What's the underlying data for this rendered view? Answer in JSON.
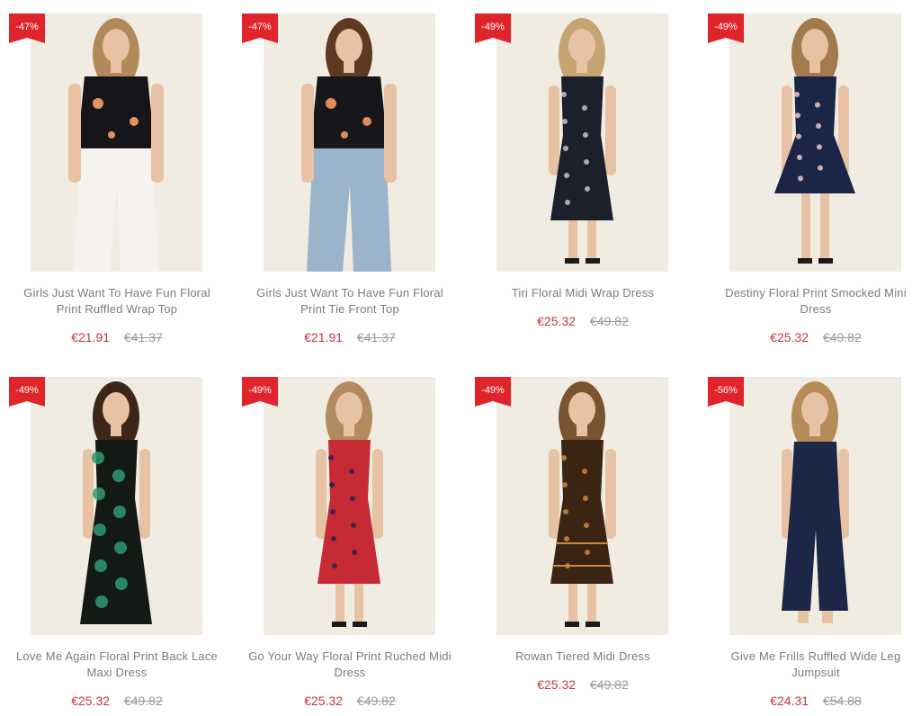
{
  "products": [
    {
      "badge": "-47%",
      "title": "Girls Just Want To Have Fun Floral Print Ruffled Wrap Top",
      "sale_price": "€21.91",
      "old_price": "€41.37",
      "colors": {
        "garment": "#16161a",
        "pattern": "#e3935f",
        "bottom": "#f6f3ee",
        "hair": "#b2895b"
      }
    },
    {
      "badge": "-47%",
      "title": "Girls Just Want To Have Fun Floral Print Tie Front Top",
      "sale_price": "€21.91",
      "old_price": "€41.37",
      "colors": {
        "garment": "#17171b",
        "pattern": "#e08c5b",
        "bottom": "#9bb3cb",
        "hair": "#5e3a22"
      }
    },
    {
      "badge": "-49%",
      "title": "Tiri Floral Midi Wrap Dress",
      "sale_price": "€25.32",
      "old_price": "€49.82",
      "colors": {
        "garment": "#1c1f2c",
        "pattern": "#c9c2d4",
        "bottom": "#1c1f2c",
        "hair": "#c6a372"
      }
    },
    {
      "badge": "-49%",
      "title": "Destiny Floral Print Smocked Mini Dress",
      "sale_price": "€25.32",
      "old_price": "€49.82",
      "colors": {
        "garment": "#1b2547",
        "pattern": "#e8c9c4",
        "bottom": "#1b2547",
        "hair": "#a37a4c"
      }
    },
    {
      "badge": "-49%",
      "title": "Love Me Again Floral Print Back Lace Maxi Dress",
      "sale_price": "€25.32",
      "old_price": "€49.82",
      "colors": {
        "garment": "#131a16",
        "pattern": "#2f9a72",
        "bottom": "#131a16",
        "hair": "#3c2618"
      }
    },
    {
      "badge": "-49%",
      "title": "Go Your Way Floral Print Ruched Midi Dress",
      "sale_price": "€25.32",
      "old_price": "€49.82",
      "colors": {
        "garment": "#c62b35",
        "pattern": "#2b2250",
        "bottom": "#c62b35",
        "hair": "#b38a5e"
      }
    },
    {
      "badge": "-49%",
      "title": "Rowan Tiered Midi Dress",
      "sale_price": "€25.32",
      "old_price": "€49.82",
      "colors": {
        "garment": "#3a2414",
        "pattern": "#c98a3d",
        "bottom": "#3a2414",
        "hair": "#7a5330"
      }
    },
    {
      "badge": "-56%",
      "title": "Give Me Frills Ruffled Wide Leg Jumpsuit",
      "sale_price": "€24.31",
      "old_price": "€54.88",
      "colors": {
        "garment": "#1c2647",
        "pattern": "#1c2647",
        "bottom": "#1c2647",
        "hair": "#b58b58"
      }
    }
  ]
}
